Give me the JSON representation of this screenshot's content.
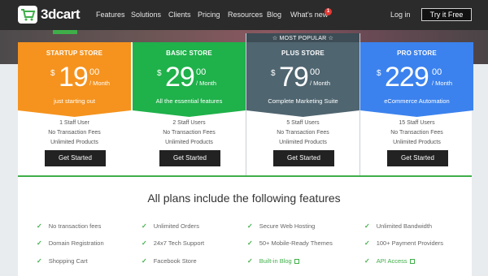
{
  "nav": {
    "logo_text": "3dcart",
    "links": [
      "Features",
      "Solutions",
      "Clients",
      "Pricing",
      "Resources",
      "Blog",
      "What's new"
    ],
    "badge": "1",
    "login": "Log in",
    "cta": "Try it Free"
  },
  "popular_label": "☆ MOST POPULAR ☆",
  "plans": [
    {
      "name": "STARTUP STORE",
      "currency": "$",
      "amount": "19",
      "cents": "00",
      "per": "/ Month",
      "tagline": "just starting out",
      "features": [
        "1 Staff User",
        "No Transaction Fees",
        "Unlimited Products"
      ],
      "button": "Get Started",
      "color": "#f5931e",
      "notch": "#f6a23a"
    },
    {
      "name": "BASIC STORE",
      "currency": "$",
      "amount": "29",
      "cents": "00",
      "per": "/ Month",
      "tagline": "All the essential features",
      "features": [
        "2 Staff Users",
        "No Transaction Fees",
        "Unlimited Products"
      ],
      "button": "Get Started",
      "color": "#1fb14a",
      "notch": "#2cba56"
    },
    {
      "name": "PLUS STORE",
      "currency": "$",
      "amount": "79",
      "cents": "00",
      "per": "/ Month",
      "tagline": "Complete Marketing Suite",
      "features": [
        "5 Staff Users",
        "No Transaction Fees",
        "Unlimited Products"
      ],
      "button": "Get Started",
      "color": "#4f6570",
      "notch": "#5c717b"
    },
    {
      "name": "PRO STORE",
      "currency": "$",
      "amount": "229",
      "cents": "00",
      "per": "/ Month",
      "tagline": "eCommerce Automation",
      "features": [
        "15 Staff Users",
        "No Transaction Fees",
        "Unlimited Products"
      ],
      "button": "Get Started",
      "color": "#3b82ee",
      "notch": "#4d8ef0"
    }
  ],
  "features_title": "All plans include the following features",
  "features": [
    [
      "No transaction fees",
      "Unlimited Orders",
      "Secure Web Hosting",
      "Unlimited Bandwidth"
    ],
    [
      "Domain Registration",
      "24x7 Tech Support",
      "50+ Mobile-Ready Themes",
      "100+ Payment Providers"
    ],
    [
      "Shopping Cart",
      "Facebook Store",
      "Built-in Blog",
      "API Access"
    ]
  ]
}
